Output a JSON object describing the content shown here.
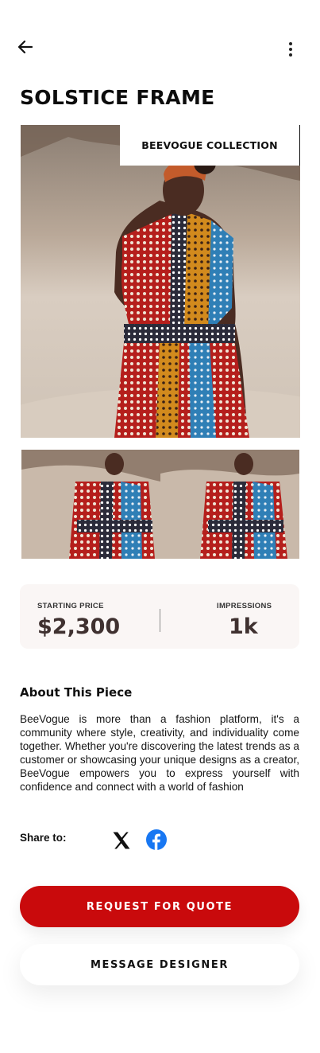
{
  "header": {
    "back_icon": "arrow-left-icon",
    "more_icon": "more-vertical-icon"
  },
  "product": {
    "title": "SOLSTICE FRAME",
    "collection_badge": "BEEVOGUE COLLECTION"
  },
  "stats": {
    "price_label": "STARTING PRICE",
    "price_value": "$2,300",
    "impressions_label": "IMPRESSIONS",
    "impressions_value": "1k"
  },
  "about": {
    "title": "About This Piece",
    "text": "BeeVogue is more than a fashion platform, it's a community where style, creativity, and individuality come together. Whether you're discovering the latest trends as a customer or showcasing your unique designs as a creator, BeeVogue empowers you to express yourself with confidence and connect with a world of fashion"
  },
  "share": {
    "label": "Share to:",
    "icons": [
      "x-icon",
      "facebook-icon"
    ]
  },
  "actions": {
    "quote_label": "REQUEST FOR QUOTE",
    "message_label": "MESSAGE DESIGNER"
  },
  "colors": {
    "primary": "#c90a0c",
    "stats_bg": "#faf6f5",
    "stats_text": "#3f3130",
    "facebook": "#1877f2"
  }
}
